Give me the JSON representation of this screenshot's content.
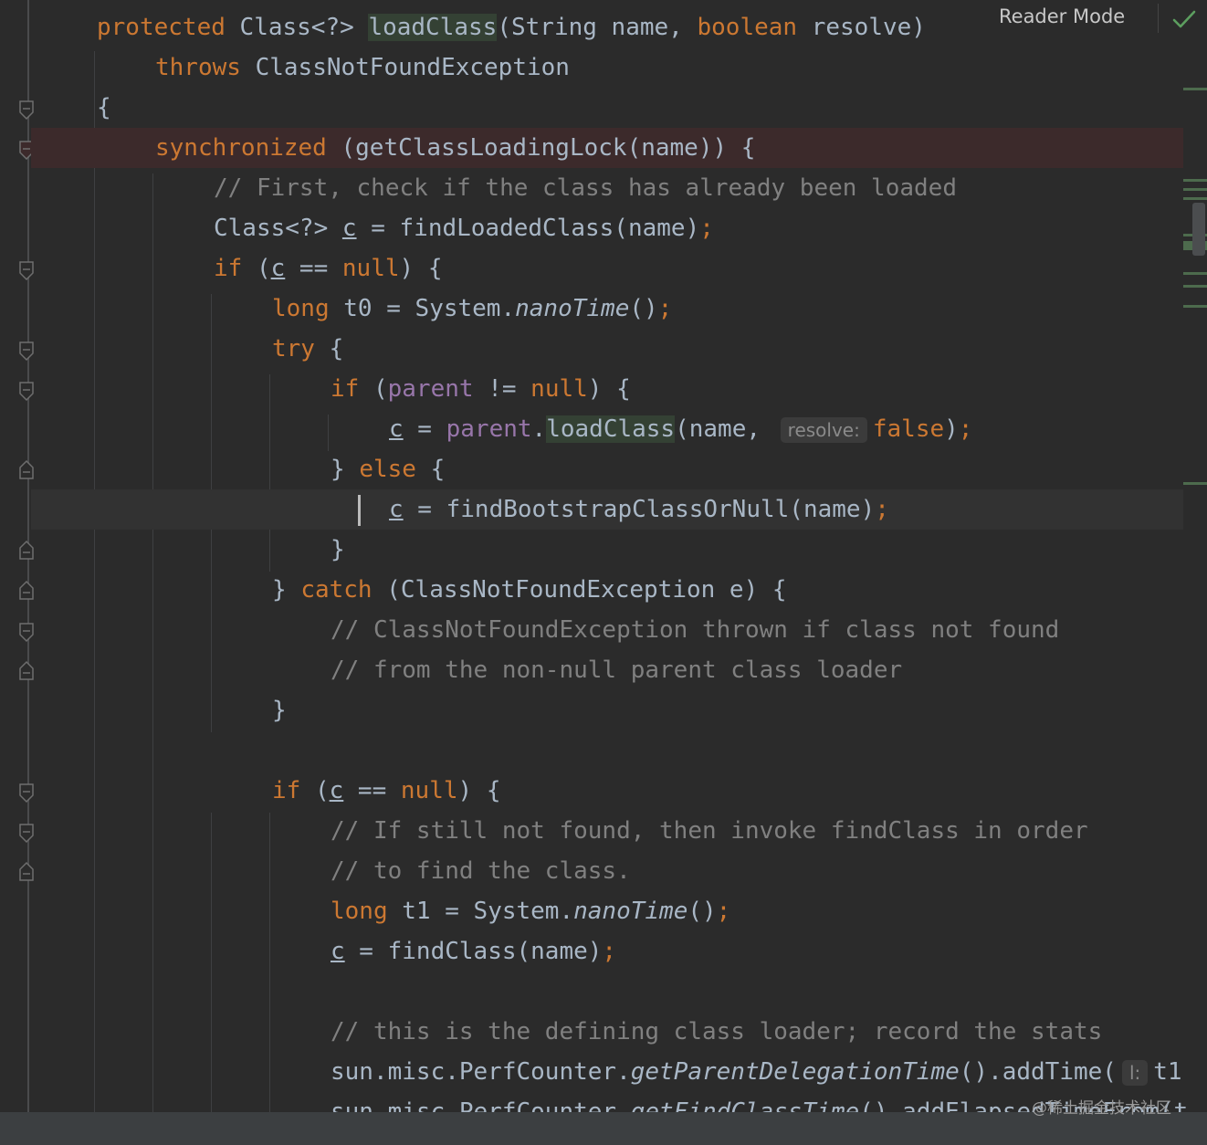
{
  "toolbar": {
    "reader_mode_label": "Reader Mode"
  },
  "watermark": "@稀土掘金技术社区",
  "hints": {
    "resolve": "resolve:",
    "l": "l:"
  },
  "code": {
    "l1": {
      "t1": "protected",
      "t2": " Class<?> ",
      "t3": "loadClass",
      "t4": "(String name, ",
      "t5": "boolean",
      "t6": " resolve)"
    },
    "l2": {
      "t1": "throws",
      "t2": " ClassNotFoundException"
    },
    "l3": {
      "t1": "{"
    },
    "l4": {
      "t1": "synchronized",
      "t2": " (getClassLoadingLock(name)) {"
    },
    "l5": {
      "t1": "// First, check if the class has already been loaded"
    },
    "l6": {
      "t1": "Class<?> ",
      "t2": "c",
      "t3": " = findLoadedClass(name)",
      "t4": ";"
    },
    "l7": {
      "t1": "if",
      "t2": " (",
      "t3": "c",
      "t4": " == ",
      "t5": "null",
      "t6": ") {"
    },
    "l8": {
      "t1": "long",
      "t2": " t0 = System.",
      "t3": "nanoTime",
      "t4": "()",
      "t5": ";"
    },
    "l9": {
      "t1": "try",
      "t2": " {"
    },
    "l10": {
      "t1": "if",
      "t2": " (",
      "t3": "parent",
      "t4": " != ",
      "t5": "null",
      "t6": ") {"
    },
    "l11": {
      "t1": "c",
      "t2": " = ",
      "t3": "parent",
      "t4": ".",
      "t5": "loadClass",
      "t6": "(name, ",
      "t7": "false",
      "t8": ")",
      "t9": ";"
    },
    "l12": {
      "t1": "} ",
      "t2": "else",
      "t3": " {"
    },
    "l13": {
      "t1": "c",
      "t2": " = findBootstrapClassOrNull(name)",
      "t3": ";"
    },
    "l14": {
      "t1": "}"
    },
    "l15": {
      "t1": "} ",
      "t2": "catch",
      "t3": " (ClassNotFoundException e) {"
    },
    "l16": {
      "t1": "// ClassNotFoundException thrown if class not found"
    },
    "l17": {
      "t1": "// from the non-null parent class loader"
    },
    "l18": {
      "t1": "}"
    },
    "l19": {
      "t1": "if",
      "t2": " (",
      "t3": "c",
      "t4": " == ",
      "t5": "null",
      "t6": ") {"
    },
    "l20": {
      "t1": "// If still not found, then invoke findClass in order"
    },
    "l21": {
      "t1": "// to find the class."
    },
    "l22": {
      "t1": "long",
      "t2": " t1 = System.",
      "t3": "nanoTime",
      "t4": "()",
      "t5": ";"
    },
    "l23": {
      "t1": "c",
      "t2": " = findClass(name)",
      "t3": ";"
    },
    "l24": {
      "t1": "// this is the defining class loader; record the stats"
    },
    "l25": {
      "t1": "sun.misc.PerfCounter.",
      "t2": "getParentDelegationTime",
      "t3": "().addTime(",
      "t4": "t1"
    },
    "l26": {
      "t1": "sun.misc.PerfCounter.",
      "t2": "getFindClassTime",
      "t3": "().addElapsedTimeFrom(t"
    }
  }
}
